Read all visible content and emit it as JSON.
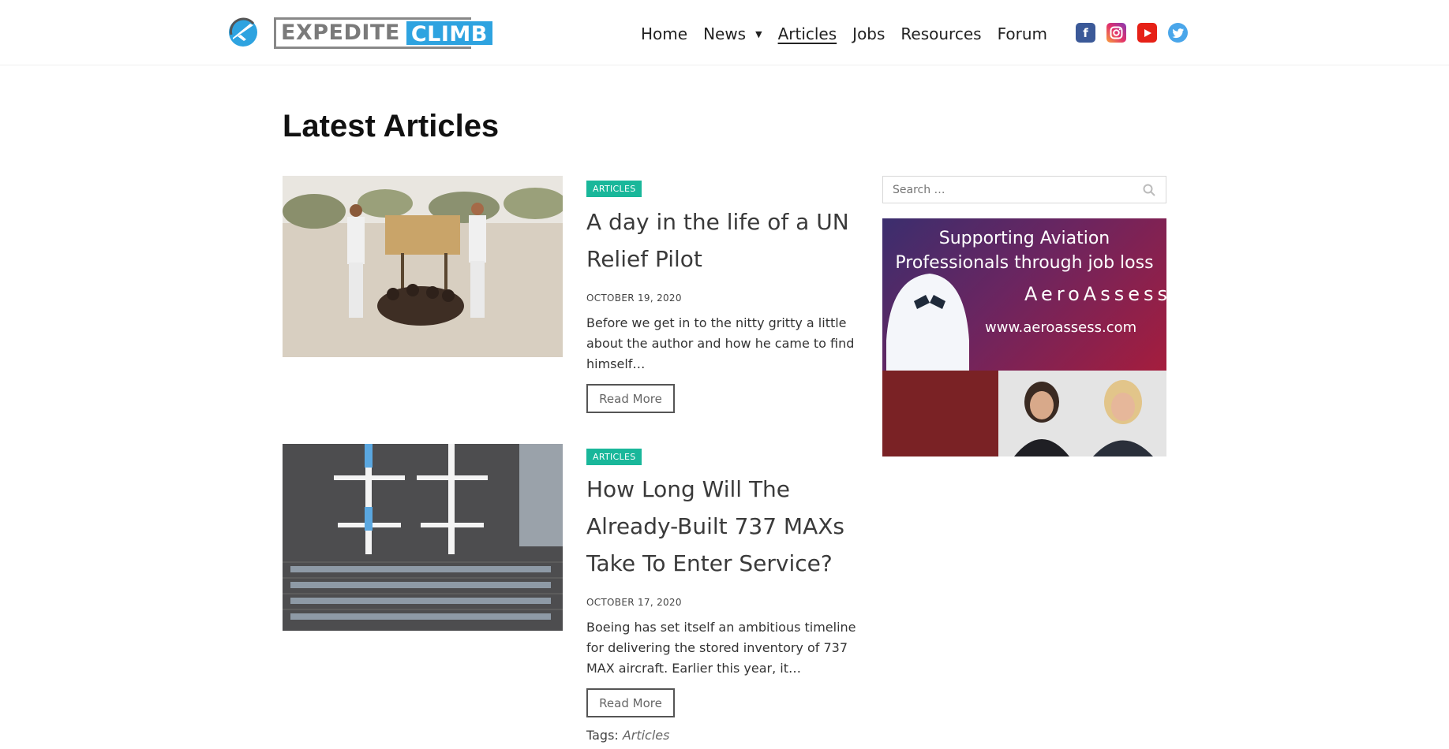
{
  "brand": {
    "logo_word1": "EXPEDITE",
    "logo_word2": "CLIMB",
    "accent_color": "#2ea3e0"
  },
  "nav": {
    "items": [
      {
        "label": "Home",
        "has_dropdown": false,
        "active": false
      },
      {
        "label": "News",
        "has_dropdown": true,
        "active": false
      },
      {
        "label": "Articles",
        "has_dropdown": false,
        "active": true
      },
      {
        "label": "Jobs",
        "has_dropdown": false,
        "active": false
      },
      {
        "label": "Resources",
        "has_dropdown": false,
        "active": false
      },
      {
        "label": "Forum",
        "has_dropdown": false,
        "active": false
      }
    ],
    "dropdown_icon": "caret-down-icon"
  },
  "socials": [
    {
      "name": "facebook-icon",
      "glyph": "f",
      "color": "#3b5998"
    },
    {
      "name": "instagram-icon",
      "glyph": "◎",
      "color": "#e1306c"
    },
    {
      "name": "youtube-icon",
      "glyph": "▶",
      "color": "#e62117"
    },
    {
      "name": "twitter-icon",
      "glyph": "🐦",
      "color": "#4aa6ea"
    }
  ],
  "main": {
    "title": "Latest Articles",
    "posts": [
      {
        "category": "ARTICLES",
        "title": "A day in the life of a UN Relief Pilot",
        "date": "OCTOBER 19, 2020",
        "excerpt": "Before we get in to the nitty gritty a little about the author and how he came to find himself…",
        "read_more": "Read More",
        "thumbnail": "pilots-welcome-sign-photo"
      },
      {
        "category": "ARTICLES",
        "title": "How Long Will The Already-Built 737 MAXs Take To Enter Service?",
        "date": "OCTOBER 17, 2020",
        "excerpt": "Boeing has set itself an ambitious timeline for delivering the stored inventory of 737 MAX aircraft. Earlier this year, it…",
        "read_more": "Read More",
        "thumbnail": "parked-737-max-aerial-photo",
        "tags_label": "Tags:",
        "tags": [
          "Articles"
        ]
      }
    ],
    "badge_color": "#19b79a"
  },
  "sidebar": {
    "search_placeholder": "Search …",
    "ad": {
      "headline": "Supporting Aviation Professionals through job loss",
      "brand": "AeroAssess",
      "url": "www.aeroassess.com"
    }
  }
}
